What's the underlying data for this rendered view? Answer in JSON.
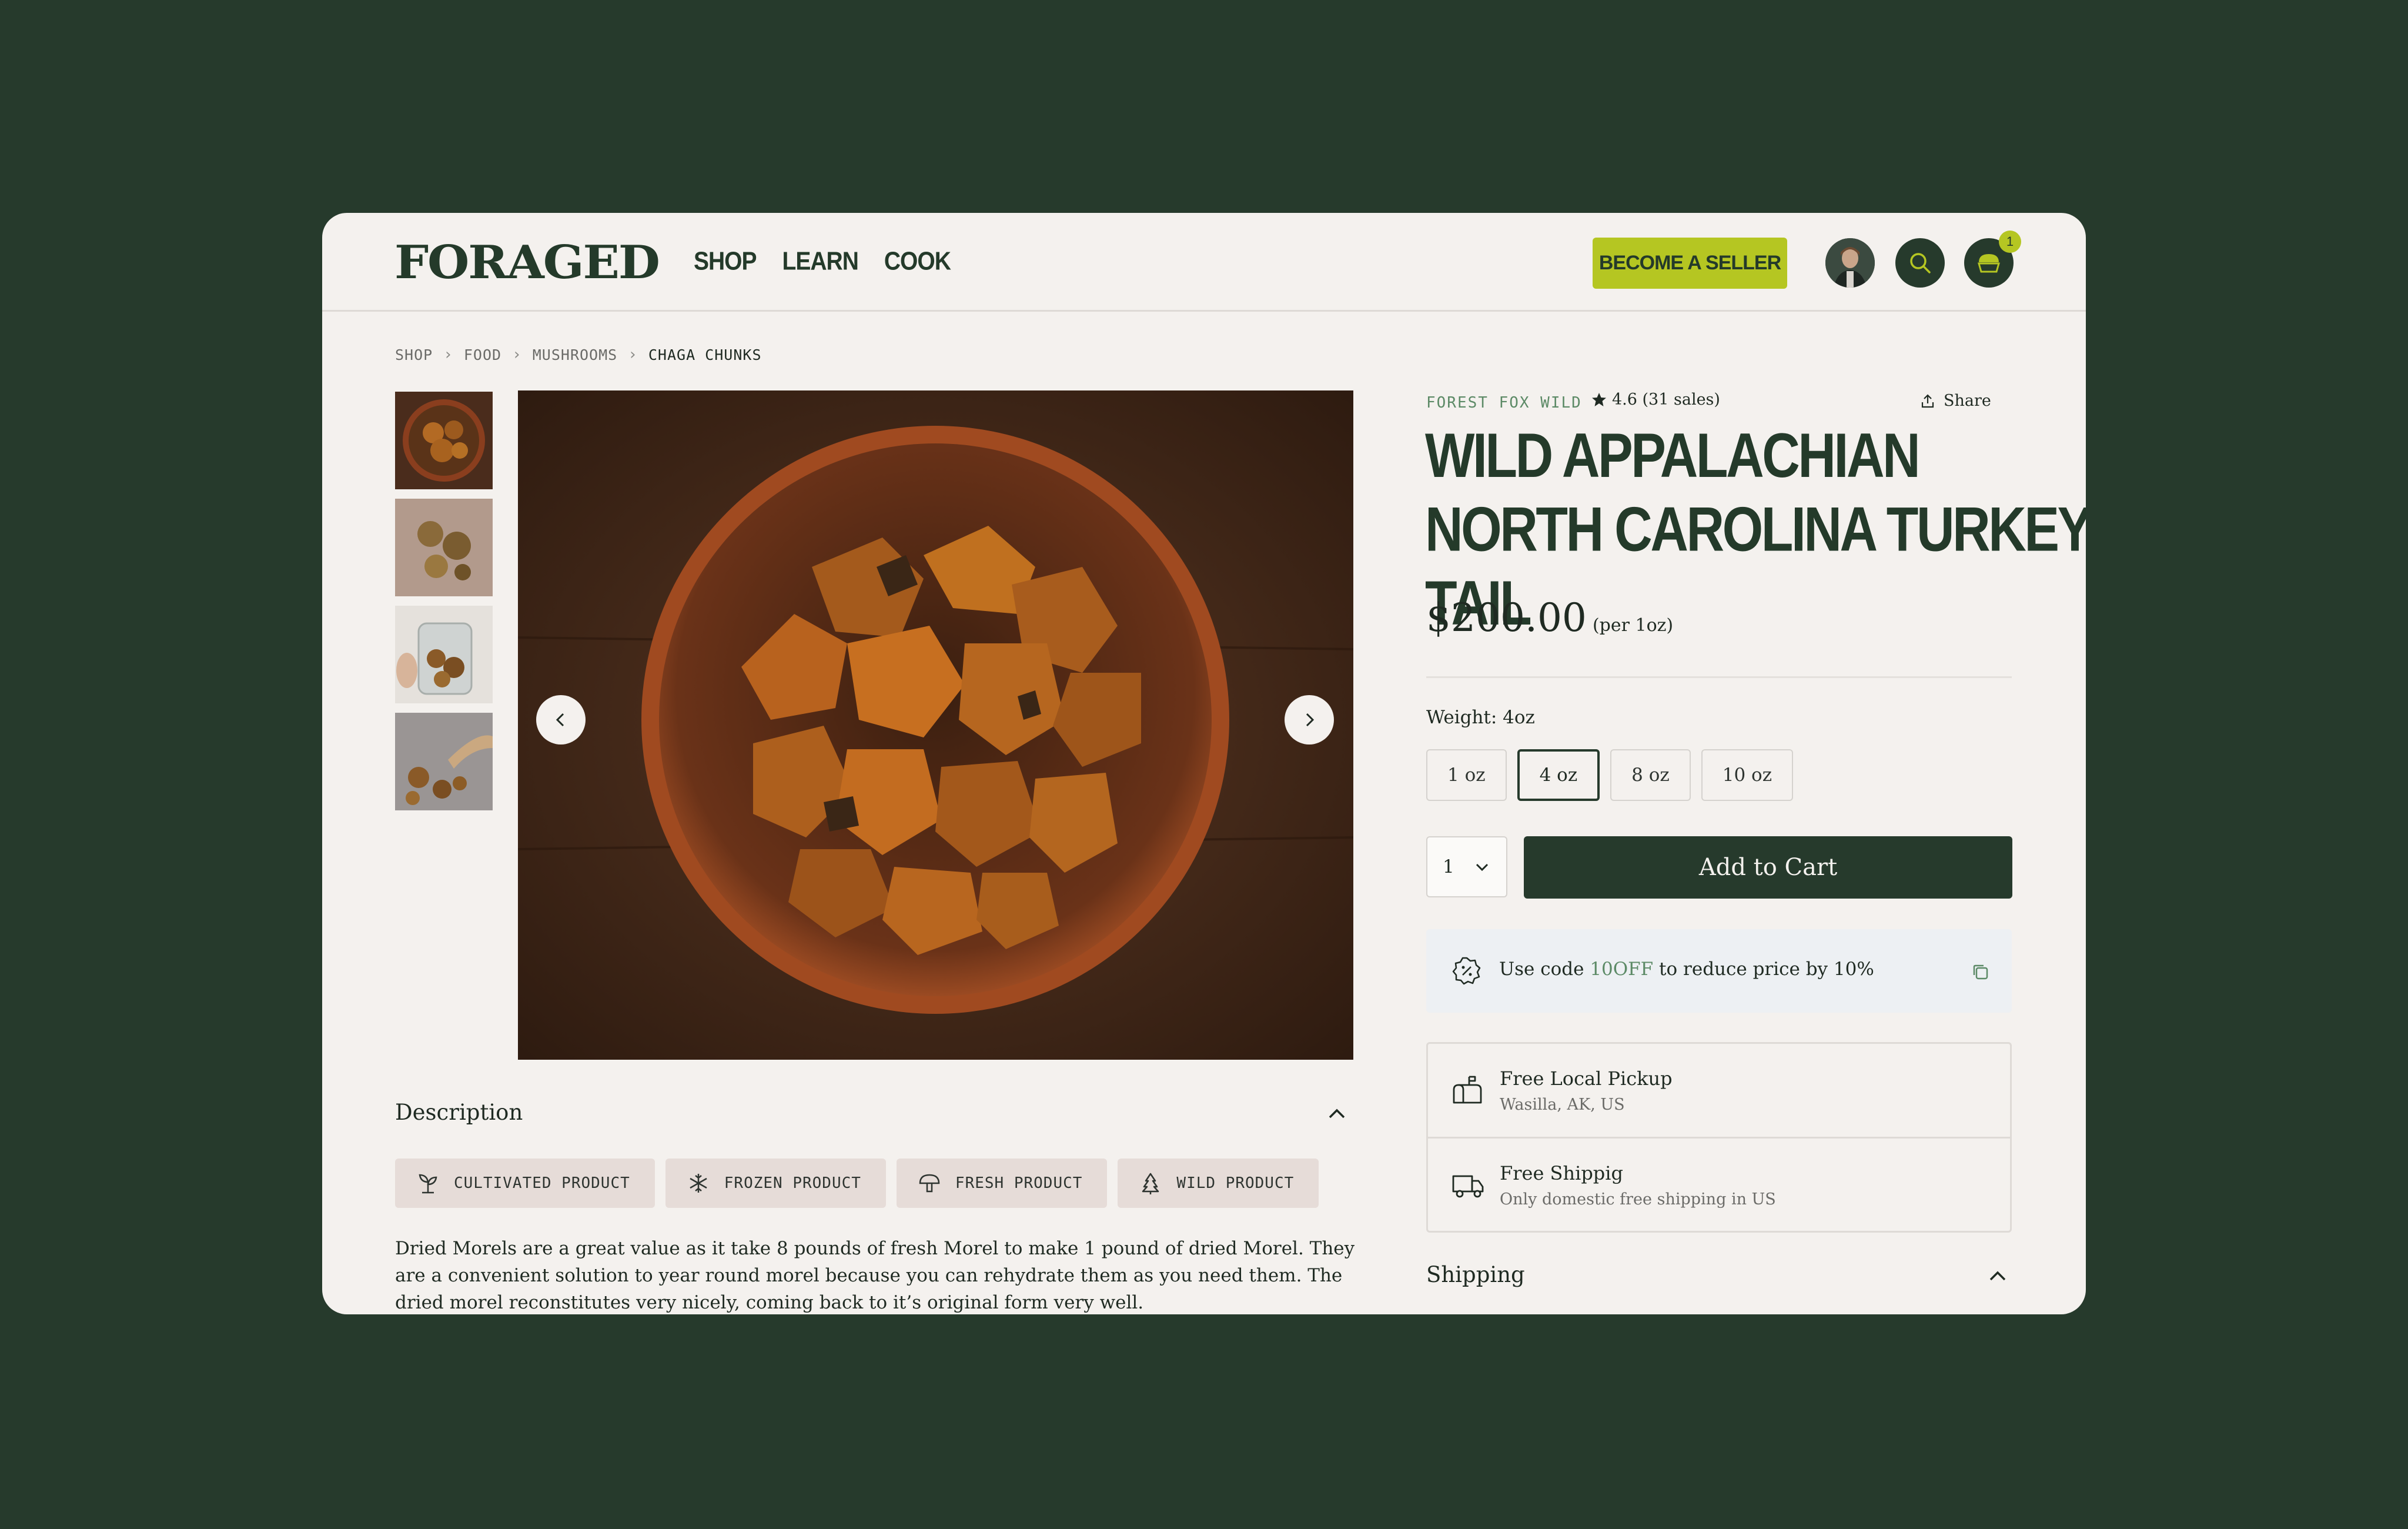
{
  "header": {
    "logo": "FORAGED",
    "nav": [
      "SHOP",
      "LEARN",
      "COOK"
    ],
    "seller_button": "BECOME A SELLER",
    "cart_count": "1"
  },
  "breadcrumb": [
    "SHOP",
    "FOOD",
    "MUSHROOMS",
    "CHAGA CHUNKS"
  ],
  "gallery": {
    "thumbnail_count": 4,
    "selected_index": 0
  },
  "description": {
    "heading": "Description",
    "tags": [
      "CULTIVATED PRODUCT",
      "FROZEN PRODUCT",
      "FRESH PRODUCT",
      "WILD PRODUCT"
    ],
    "text": "Dried Morels are a great value as it take 8 pounds of fresh Morel to make 1 pound of dried Morel. They are a convenient solution to year round morel because you can rehydrate them as you need them.  The dried morel reconstitutes very nicely, coming back to it’s original form very well."
  },
  "product": {
    "seller": "FOREST FOX WILD",
    "rating": "4.6 (31 sales)",
    "share_label": "Share",
    "title": "WILD APPALACHIAN NORTH CAROLINA TURKEY TAIL",
    "price": "$200.00",
    "price_unit": "(per 1oz)",
    "weight_label": "Weight: 4oz",
    "weight_options": [
      "1 oz",
      "4 oz",
      "8 oz",
      "10 oz"
    ],
    "selected_weight": "4 oz",
    "quantity": "1",
    "add_to_cart": "Add to Cart"
  },
  "promo": {
    "prefix": "Use code ",
    "code": "10OFF",
    "suffix": " to reduce price by 10%"
  },
  "delivery": [
    {
      "title": "Free Local Pickup",
      "subtitle": "Wasilla, AK, US"
    },
    {
      "title": "Free Shippig",
      "subtitle": "Only domestic free shipping in US"
    }
  ],
  "shipping_heading": "Shipping",
  "colors": {
    "background": "#263a2c",
    "accent": "#b5c622",
    "brand_green": "#5c8a66",
    "card": "#f4f1ee"
  }
}
